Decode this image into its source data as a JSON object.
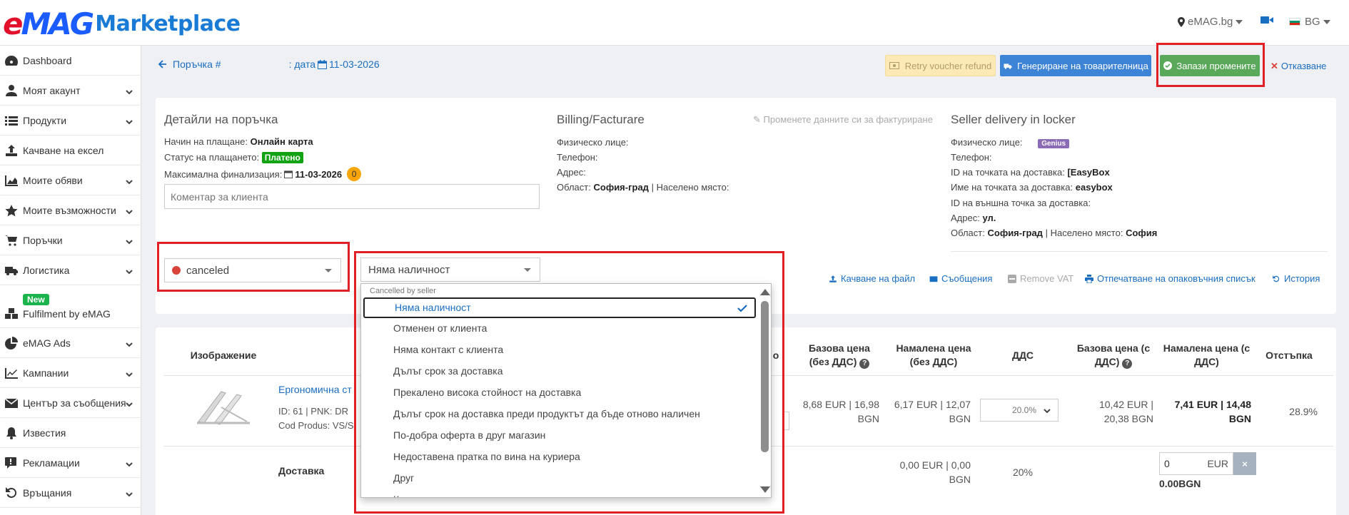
{
  "topbar": {
    "logo_brand_red": "e",
    "logo_brand_blue": "MAG",
    "logo_suffix": "Marketplace",
    "site_selector": "eMAG.bg",
    "language": "BG"
  },
  "sidebar": {
    "items": [
      {
        "label": "Dashboard",
        "icon": "dashboard-icon"
      },
      {
        "label": "Моят акаунт",
        "icon": "user-icon"
      },
      {
        "label": "Продукти",
        "icon": "list-icon"
      },
      {
        "label": "Качване на ексел",
        "icon": "upload-icon"
      },
      {
        "label": "Моите обяви",
        "icon": "area-chart-icon"
      },
      {
        "label": "Моите възможности",
        "icon": "star-icon"
      },
      {
        "label": "Поръчки",
        "icon": "cart-icon"
      },
      {
        "label": "Логистика",
        "icon": "truck-icon"
      },
      {
        "label": "Fulfilment by eMAG",
        "icon": "cubes-icon",
        "badge": "New"
      },
      {
        "label": "eMAG Ads",
        "icon": "pie-chart-icon"
      },
      {
        "label": "Кампании",
        "icon": "line-chart-icon"
      },
      {
        "label": "Център за съобщения",
        "icon": "envelope-icon"
      },
      {
        "label": "Известия",
        "icon": "bell-icon"
      },
      {
        "label": "Рекламации",
        "icon": "exclamation-icon"
      },
      {
        "label": "Връщания",
        "icon": "undo-icon"
      }
    ]
  },
  "header": {
    "order_label": "Поръчка #",
    "date_label": ": дата",
    "date_value": "11-03-2026",
    "retry_button": "Retry voucher refund",
    "generate_button": "Генериране на товарителница",
    "save_button": "Запази промените",
    "cancel_link": "Отказване"
  },
  "details": {
    "title": "Детайли на поръчка",
    "payment_method_label": "Начин на плащане:",
    "payment_method_value": "Онлайн карта",
    "payment_status_label": "Статус на плащането:",
    "payment_status_value": "Платено",
    "max_finalization_label": "Максимална финализация:",
    "max_finalization_value": "11-03-2026",
    "max_finalization_count": "0",
    "comment_placeholder": "Коментар за клиента"
  },
  "billing": {
    "title": "Billing/Facturare",
    "change_link": "Променете данните си за фактуриране",
    "person_label": "Физическо лице:",
    "phone_label": "Телефон:",
    "address_label": "Адрес:",
    "region_label": "Област:",
    "region_value": "София-град",
    "sep": "|",
    "locality_label": "Населено място:"
  },
  "delivery": {
    "title": "Seller delivery in locker",
    "person_label": "Физическо лице:",
    "genius_badge": "Genius",
    "phone_label": "Телефон:",
    "point_id_label": "ID на точката на доставка:",
    "point_id_value": "[EasyBox",
    "point_name_label": "Име на точката за доставка:",
    "point_name_value": "easybox",
    "external_id_label": "ID на външна точка за доставка:",
    "address_label": "Адрес:",
    "address_value": "ул.",
    "region_label": "Област:",
    "region_value": "София-град",
    "sep": "|",
    "locality_label": "Населено място:",
    "locality_value": "София"
  },
  "status_select": {
    "value": "canceled",
    "dot_color": "#d9443a"
  },
  "reason_select": {
    "value": "Няма наличност",
    "group_label": "Cancelled by seller",
    "options": [
      "Няма наличност",
      "Отменен от клиента",
      "Няма контакт с клиента",
      "Дълъг срок за доставка",
      "Прекалено висока стойност на доставка",
      "Дълъг срок на доставка преди продуктът да бъде отново наличен",
      "По-добра оферта в друг магазин",
      "Недоставена пратка по вина на куриера",
      "Друг",
      "Клиентът промени решението си"
    ],
    "selected_index": 0
  },
  "actions": {
    "upload_file": "Качване на файл",
    "messages": "Съобщения",
    "remove_vat": "Remove VAT",
    "print_packing": "Отпечатване на опаковъчния списък",
    "history": "История"
  },
  "table": {
    "headers": {
      "image": "Изображение",
      "partial_o": "о",
      "base_price_excl": "Базова цена (без ДДС)",
      "disc_price_excl": "Намалена цена (без ДДС)",
      "vat": "ДДС",
      "base_price_incl": "Базова цена (с ДДС)",
      "disc_price_incl": "Намалена цена (с ДДС)",
      "discount": "Отстъпка"
    },
    "product": {
      "name_partial": "Ергономична ст",
      "meta_partial": "ID: 61 | PNK: DR",
      "code_partial": "Cod Produs: VS/S",
      "base_excl_line1": "8,68 EUR | 16,98",
      "base_excl_line2": "BGN",
      "disc_excl_line1": "6,17 EUR | 12,07",
      "disc_excl_line2": "BGN",
      "vat_value": "20.0%",
      "base_incl_line1": "10,42 EUR |",
      "base_incl_line2": "20,38 BGN",
      "disc_incl_line1": "7,41 EUR | 14,48",
      "disc_incl_line2": "BGN",
      "discount": "28.9%"
    },
    "delivery_row": {
      "label": "Доставка",
      "disc_excl_line1": "0,00 EUR | 0,00",
      "disc_excl_line2": "BGN",
      "vat": "20%",
      "input_value": "0",
      "input_unit": "EUR",
      "clear": "×",
      "bgn_value": "0.00BGN"
    }
  },
  "colors": {
    "highlight_border": "#e01f26",
    "link_blue": "#1a6ec2",
    "save_green": "#5aa85a",
    "generate_blue": "#3e84d6"
  }
}
